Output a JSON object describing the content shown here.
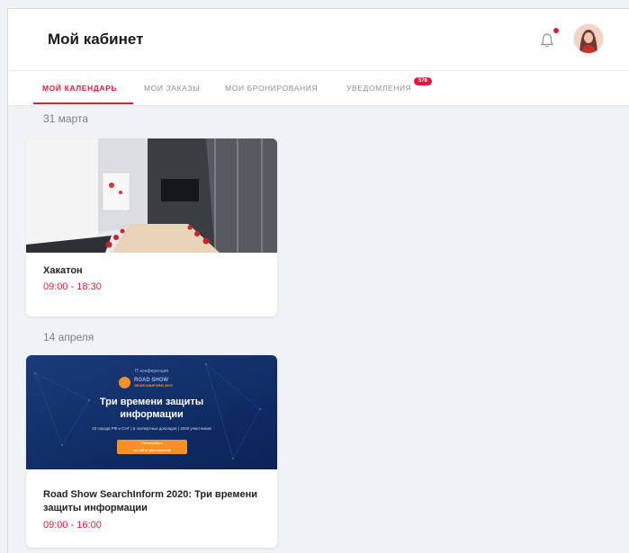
{
  "header": {
    "title": "Мой кабинет"
  },
  "tabs": [
    {
      "label": "Мой календарь",
      "active": true
    },
    {
      "label": "Мои заказы",
      "active": false
    },
    {
      "label": "Мои бронирования",
      "active": false
    },
    {
      "label": "Уведомления",
      "active": false,
      "badge": "576"
    }
  ],
  "groups": [
    {
      "date": "31 марта",
      "events": [
        {
          "title": "Хакатон",
          "time": "09:00 - 18:30"
        }
      ]
    },
    {
      "date": "14 апреля",
      "events": [
        {
          "title": "Road Show SearchInform 2020: Три времени защиты информации",
          "time": "09:00 - 16:00"
        }
      ]
    }
  ],
  "banner": {
    "small": "IT-конференция",
    "logo_line1": "ROAD SHOW",
    "logo_line2": "SEARCHINFORM 2020",
    "headline_line1": "Три времени защиты",
    "headline_line2": "информации",
    "subline": "23 города РФ и СНГ | 6 экспертных докладов | 4000 участников",
    "button_line1": "Регистрация",
    "button_line2": "на сайте мероприятия"
  },
  "colors": {
    "accent": "#e21b3c",
    "background": "#f0f2f5",
    "banner_orange": "#f39325",
    "banner_blue": "#12306a"
  }
}
